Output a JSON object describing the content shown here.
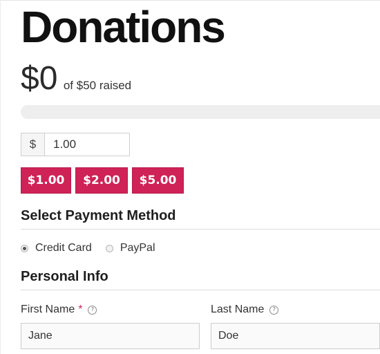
{
  "form": {
    "title": "Donations",
    "raised_amount": "$0",
    "goal_text": "of $50 raised",
    "progress_percent": 0,
    "currency_symbol": "$",
    "amount_value": "1.00",
    "accent_color": "#cf2257",
    "levels": [
      {
        "label": "$1.00"
      },
      {
        "label": "$2.00"
      },
      {
        "label": "$5.00"
      }
    ]
  },
  "payment": {
    "heading": "Select Payment Method",
    "methods": [
      {
        "label": "Credit Card",
        "selected": true
      },
      {
        "label": "PayPal",
        "selected": false
      }
    ]
  },
  "personal": {
    "heading": "Personal Info",
    "first_name": {
      "label": "First Name",
      "required_mark": "*",
      "value": "Jane",
      "help_icon": "question-circle-icon"
    },
    "last_name": {
      "label": "Last Name",
      "value": "Doe",
      "help_icon": "question-circle-icon"
    }
  }
}
